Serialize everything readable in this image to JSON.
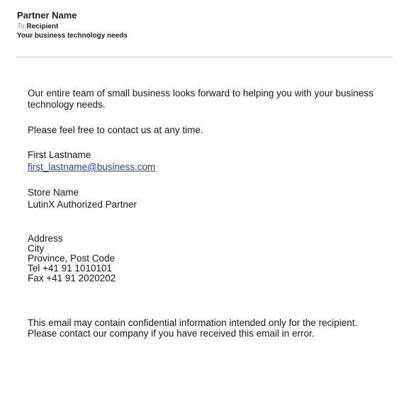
{
  "header": {
    "sender": "Partner Name",
    "to_label": "To:",
    "to_value": "Recipient",
    "subject": "Your business technology needs"
  },
  "body": {
    "paragraph_1": "Our entire team of small business looks forward to helping you with your business technology needs.",
    "paragraph_2": "Please feel free to contact us at any time.",
    "signature_name": "First Lastname",
    "signature_email": "first_lastname@business.com",
    "store_name": "Store Name",
    "store_subtitle": "LutinX Authorized Partner",
    "address": {
      "line_1": "Address",
      "city": "City",
      "province_post": "Province, Post Code",
      "tel": "Tel +41 91 1010101",
      "fax": "Fax +41 91 2020202"
    },
    "disclaimer": "This email may contain confidential information intended only for the recipient. Please contact our company if you have received this email in error."
  },
  "colors": {
    "link": "#1f3fc8",
    "text": "#1a1a1a",
    "muted": "#8a8a8a",
    "divider": "#c8c8c8"
  }
}
